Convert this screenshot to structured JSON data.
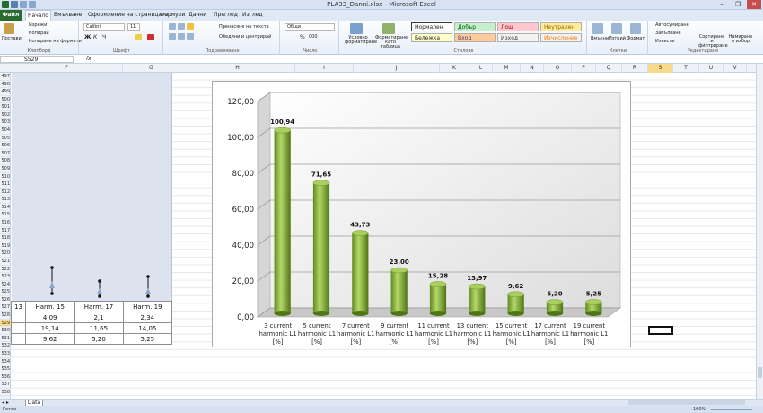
{
  "window": {
    "title": "PLA33_Danni.xlsx - Microsoft Excel",
    "minimize": "–",
    "restore": "❐",
    "close": "✕"
  },
  "tabs": {
    "file": "Файл",
    "items": [
      "Начало",
      "Вмъкване",
      "Оформление на страницата",
      "Формули",
      "Данни",
      "Преглед",
      "Изглед"
    ],
    "active": 0
  },
  "ribbon": {
    "clipboard": {
      "paste": "Постави",
      "cut": "Изрежи",
      "copy": "Копирай",
      "format_painter": "Копиране на формати",
      "label": "Клипборд"
    },
    "font": {
      "name": "Calibri",
      "size": "11",
      "bold": "Ж",
      "italic": "К",
      "underline": "Ч",
      "label": "Шрифт"
    },
    "alignment": {
      "wrap": "Пренасяне на текста",
      "merge": "Обедини и центрирай",
      "label": "Подравняване"
    },
    "number": {
      "format": "Общи",
      "percent": "%",
      "thousands": "000",
      "label": "Число"
    },
    "styles": {
      "conditional": "Условно форматиране",
      "as_table": "Форматиране като таблица",
      "normal": "Нормален",
      "good": "Добър",
      "bad": "Лош",
      "neutral": "Неутрален",
      "note": "Бележка",
      "input": "Вход",
      "output": "Изход",
      "calculation": "Изчисление",
      "label": "Стилове"
    },
    "cells": {
      "insert": "Вмъкни",
      "delete": "Изтрий",
      "format": "Формат",
      "label": "Клетки"
    },
    "editing": {
      "autosum": "Автосумиране",
      "fill": "Запълване",
      "clear": "Изчисти",
      "sort": "Сортиране и филтриране",
      "find": "Намиране и избор",
      "label": "Редактиране"
    }
  },
  "formula": {
    "name_box": "S529",
    "fx": "fx",
    "value": ""
  },
  "columns": [
    "F",
    "G",
    "H",
    "I",
    "J",
    "K",
    "L",
    "M",
    "N",
    "O",
    "P",
    "Q",
    "R",
    "S",
    "T",
    "U",
    "V"
  ],
  "selected_column": "S",
  "rows": [
    "497",
    "498",
    "499",
    "500",
    "501",
    "502",
    "503",
    "504",
    "505",
    "506",
    "507",
    "508",
    "509",
    "510",
    "511",
    "512",
    "513",
    "514",
    "515",
    "516",
    "517",
    "518",
    "519",
    "520",
    "521",
    "522",
    "523",
    "524",
    "525",
    "526",
    "527",
    "528",
    "529",
    "530",
    "531",
    "532",
    "533",
    "534",
    "535",
    "536",
    "537",
    "538"
  ],
  "selected_row": "529",
  "table": {
    "header": [
      "13",
      "Harm. 15",
      "Harm. 17",
      "Harm. 19"
    ],
    "rows": [
      [
        "",
        "4,09",
        "2,1",
        "2,34"
      ],
      [
        "",
        "19,14",
        "11,65",
        "14,05"
      ],
      [
        "",
        "9,62",
        "5,20",
        "5,25"
      ]
    ]
  },
  "chart_data": {
    "type": "bar",
    "categories": [
      "3 current harmonic L1 [%]",
      "5 current harmonic L1 [%]",
      "7 current harmonic L1 [%]",
      "9 current harmonic L1 [%]",
      "11 current harmonic L1 [%]",
      "13 current harmonic L1 [%]",
      "15 current harmonic L1 [%]",
      "17 current harmonic L1 [%]",
      "19 current harmonic L1 [%]"
    ],
    "values": [
      100.94,
      71.65,
      43.73,
      23.0,
      15.28,
      13.97,
      9.62,
      5.2,
      5.25
    ],
    "value_labels": [
      "100,94",
      "71,65",
      "43,73",
      "23,00",
      "15,28",
      "13,97",
      "9,62",
      "5,20",
      "5,25"
    ],
    "yticks": [
      "0,00",
      "20,00",
      "40,00",
      "60,00",
      "80,00",
      "100,00",
      "120,00"
    ],
    "ylim": [
      0,
      120
    ],
    "grid": true,
    "legend": "none",
    "bar_color": "#8ab33a"
  },
  "sheet": {
    "tab": "Data"
  },
  "status": {
    "ready": "Готов",
    "zoom": "100%"
  }
}
